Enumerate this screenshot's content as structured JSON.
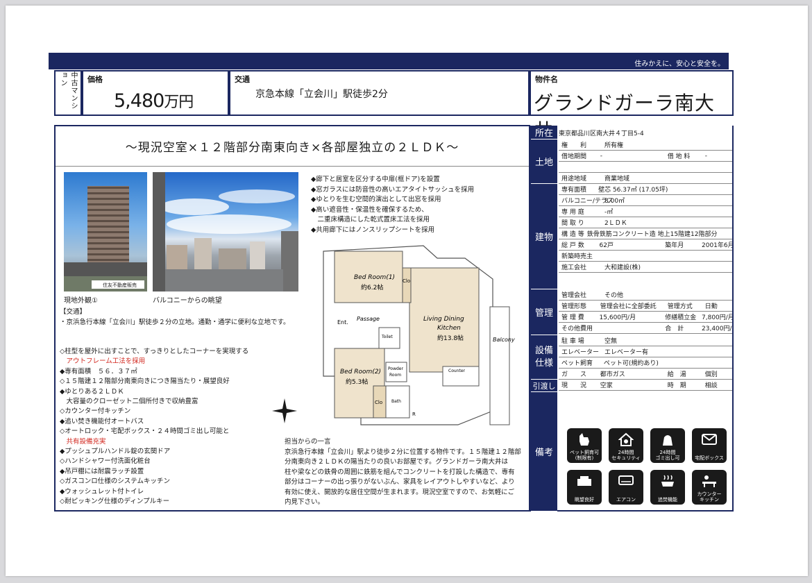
{
  "header": {
    "tagline": "住みかえに、安心と安全を。",
    "type": "中古マンション",
    "price_label": "価格",
    "price_value": "5,480",
    "price_unit": "万円",
    "traffic_label": "交通",
    "traffic_value": "京急本線「立会川」駅徒歩2分",
    "name_label": "物件名",
    "name_value": "グランドガーラ南大井"
  },
  "headline": "〜現況空室×１２階部分南東向き×各部屋独立の２ＬＤＫ〜",
  "photos": {
    "exterior_caption": "現地外観①",
    "balcony_caption": "バルコニーからの眺望",
    "watermark": "住友不動産販売"
  },
  "features_top": [
    "◆廊下と居室を区分する中扉(框ドア)を設置",
    "◆窓ガラスには防音性の高いエアタイトサッシュを採用",
    "◆ゆとりを生む空間的演出として出窓を採用",
    "◆高い遮音性・保温性を確保するため、",
    "　二重床構造にした乾式置床工法を採用",
    "◆共用廊下にはノンスリップシートを採用"
  ],
  "traffic_section": {
    "title": "【交通】",
    "text": "・京浜急行本線「立会川」駅徒歩２分の立地。通勤・通学に便利な立地です。"
  },
  "features_main": [
    "◇柱型を屋外に出すことで、すっきりとしたコーナーを実現する",
    "　アウトフレーム工法を採用",
    "◆専有面積　５６．３７㎡",
    "◇１５階建１２階部分南東向きにつき陽当たり・展望良好",
    "◆ゆとりある２ＬＤＫ",
    "　大容量のクローゼット二個所付きで収納豊富",
    "◇カウンター付キッチン",
    "◆追い焚き機能付オートバス",
    "◇オートロック・宅配ボックス・２４時間ゴミ出し可能と",
    "　共有設備充実",
    "◆プッシュプルハンドル錠の玄関ドア",
    "◇ハンドシャワー付洗面化粧台",
    "◆吊戸棚には耐震ラッチ設置",
    "◇ガスコンロ仕様のシステムキッチン",
    "◆ウォッシュレット付トイレ",
    "◇耐ピッキング仕様のディンプルキー"
  ],
  "comment": {
    "title": "担当からの一言",
    "lines": [
      "京浜急行本線「立会川」駅より徒歩２分に位置する物件です。１５階建１２階部",
      "分南東向き２ＬＤＫの陽当たりの良いお部屋です。グランドガーラ南大井は",
      "柱や梁などの鉄骨の周囲に鉄筋を組んでコンクリートを打設した構造で、専有",
      "部分はコーナーの出っ張りがないぶん、家具をレイアウトしやすいなど、より",
      "有効に使え、開放的な居住空間が生まれます。現況空室ですので、お気軽にご",
      "内見下さい。"
    ]
  },
  "floorplan": {
    "bed1": "Bed Room(1)",
    "bed1_size": "約6.2帖",
    "bed2": "Bed Room(2)",
    "bed2_size": "約5.3帖",
    "ldk": "Living Dining",
    "ldk2": "Kitchen",
    "ldk_size": "約13.8帖",
    "balcony": "Balcony",
    "entrance": "Ent.",
    "passage": "Passage",
    "clo": "Clo",
    "toilet": "Toilet",
    "powder": "Powder",
    "powder2": "Room",
    "counter": "Counter",
    "bath": "Bath",
    "r": "R"
  },
  "right": {
    "location_label": "所在",
    "location": "東京都品川区南大井４丁目5-4",
    "land_label": "土地",
    "land_rows": [
      [
        "権　　利",
        "所有権",
        "",
        ""
      ],
      [
        "借地期間",
        "-",
        "借 地 料",
        "-"
      ],
      [
        "",
        "",
        "",
        ""
      ],
      [
        "用途地域",
        "商業地域",
        "",
        ""
      ]
    ],
    "building_label": "建物",
    "building_rows": [
      [
        "専有面積",
        "壁芯 56.37㎡ (17.05坪)",
        "",
        ""
      ],
      [
        "バルコニー/テラス",
        "8.00㎡",
        "",
        ""
      ],
      [
        "専 用 庭",
        "-㎡",
        "",
        ""
      ],
      [
        "間 取 り",
        "2ＬＤＫ",
        "",
        ""
      ],
      [
        "構 造 等",
        "鉄骨鉄筋コンクリート造 地上15階建12階部分",
        "",
        ""
      ],
      [
        "総 戸 数",
        "62戸",
        "築年月",
        "2001年6月"
      ],
      [
        "新築時売主",
        "",
        "",
        ""
      ],
      [
        "施工会社",
        "大和建設(株)",
        "",
        ""
      ]
    ],
    "mgmt_label": "管理",
    "mgmt_rows": [
      [
        "管理会社",
        "その他",
        "",
        ""
      ],
      [
        "管理形態",
        "管理会社に全部委託",
        "管理方式",
        "日勤"
      ],
      [
        "管 理 費",
        "15,600円/月",
        "修繕積立金",
        "7,800円/月"
      ],
      [
        "その他費用",
        "",
        "合　計",
        "23,400円/月"
      ]
    ],
    "equip_label": "設備\n仕様",
    "equip_rows": [
      [
        "駐 車 場",
        "空無",
        "",
        ""
      ],
      [
        "エレベーター",
        "エレベーター有",
        "",
        ""
      ],
      [
        "ペット飼育",
        "ペット可(規約あり)",
        "",
        ""
      ],
      [
        "ガ　　ス",
        "都市ガス",
        "給　湯",
        "個別"
      ]
    ],
    "handover_label": "引渡し",
    "handover_row": [
      "現　　況",
      "空家",
      "時　期",
      "相談"
    ],
    "remarks_label": "備考",
    "icons": [
      "ペット飼育可\n(制限有)",
      "24時間\nセキュリティ",
      "24時間\nゴミ出し可",
      "宅配ボックス",
      "眺望良好",
      "エアコン",
      "追焚機能",
      "カウンター\nキッチン"
    ]
  }
}
